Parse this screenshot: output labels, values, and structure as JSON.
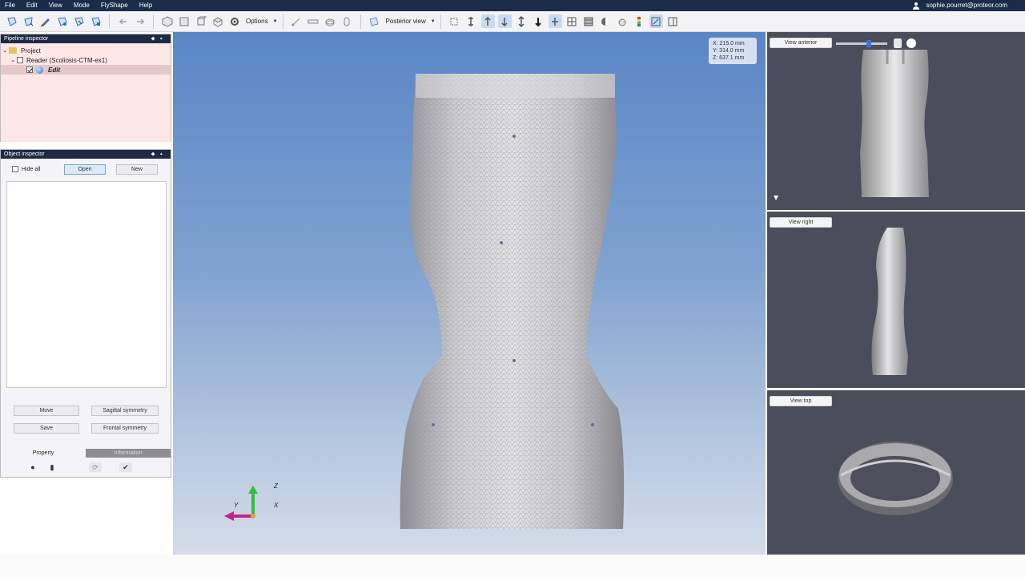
{
  "menu": {
    "items": [
      "File",
      "Edit",
      "View",
      "Mode",
      "FlyShape",
      "Help"
    ],
    "user_email": "sophie.pourret@proteor.com",
    "user_icon": "user-icon"
  },
  "toolbar": {
    "options_label": "Options",
    "view_dropdown_label": "Posterior view"
  },
  "pipeline_inspector": {
    "title": "Pipeline inspector",
    "tree": {
      "project": "Project",
      "reader": "Reader (Scoliosis-CTM-ex1)",
      "edit": "Edit"
    }
  },
  "object_inspector": {
    "title": "Object inspector",
    "hide_all_label": "Hide all",
    "open_label": "Open",
    "new_label": "New",
    "move_label": "Move",
    "save_label": "Save",
    "sagittal_label": "Sagittal symmetry",
    "frontal_label": "Frontal symmetry",
    "tabs": [
      "Property",
      "Information"
    ]
  },
  "viewport": {
    "coords": {
      "x": "X: 215.0 mm",
      "y": "Y: 314.0 mm",
      "z": "Z: 637.1 mm"
    },
    "axis_labels": {
      "z": "Z",
      "y": "Y",
      "x": "X"
    }
  },
  "side_views": {
    "anterior": "View anterior",
    "right": "View right",
    "top": "View top"
  },
  "colors": {
    "menubar": "#1b2b4a",
    "panel_title": "#1e2a44",
    "pipeline_bg": "#fce6e6",
    "side_view_bg": "#4b4d5a",
    "accent": "#2f7ad6"
  }
}
